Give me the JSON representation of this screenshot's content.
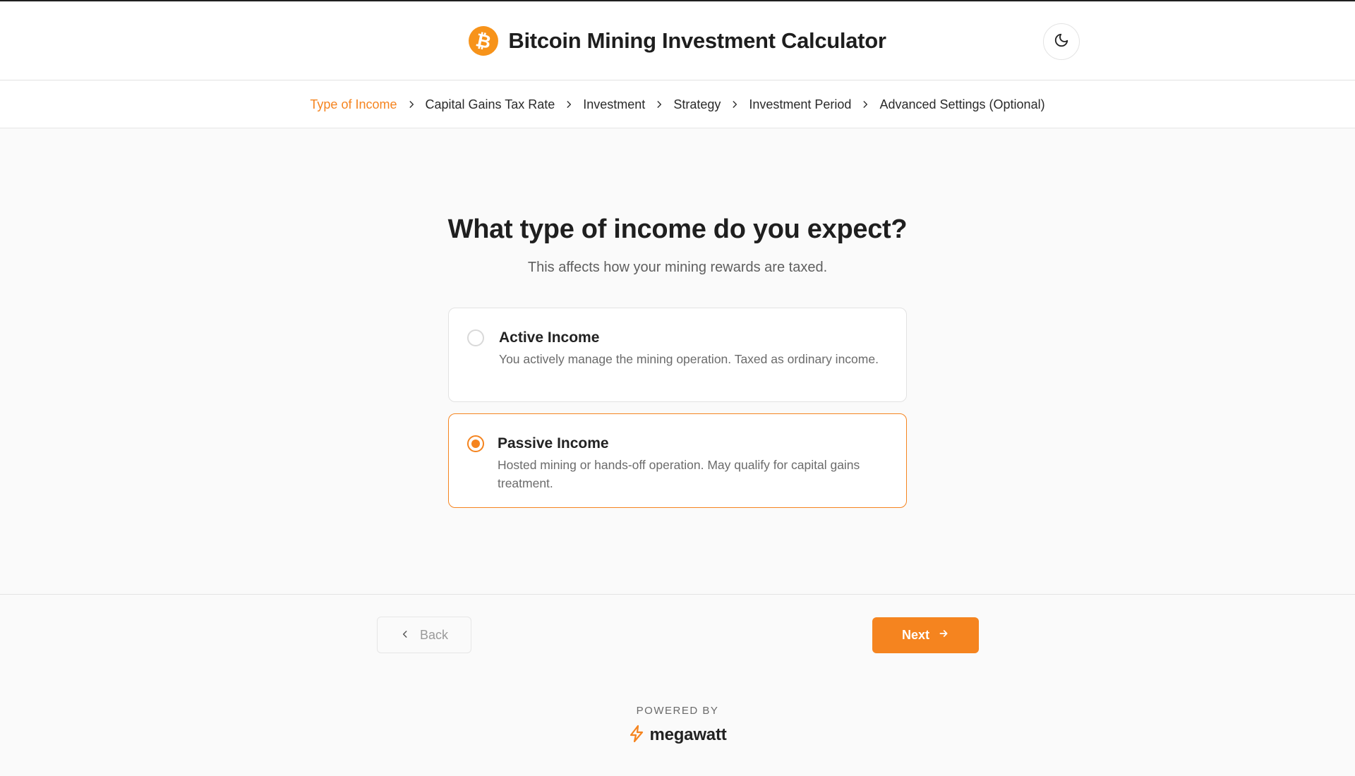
{
  "header": {
    "logo_symbol": "₿",
    "title": "Bitcoin Mining Investment Calculator",
    "theme_toggle_icon": "moon-icon"
  },
  "steps": [
    {
      "label": "Type of Income",
      "active": true
    },
    {
      "label": "Capital Gains Tax Rate",
      "active": false
    },
    {
      "label": "Investment",
      "active": false
    },
    {
      "label": "Strategy",
      "active": false
    },
    {
      "label": "Investment Period",
      "active": false
    },
    {
      "label": "Advanced Settings (Optional)",
      "active": false
    }
  ],
  "main": {
    "question": "What type of income do you expect?",
    "subtitle": "This affects how your mining rewards are taxed.",
    "options": [
      {
        "title": "Active Income",
        "description": "You actively manage the mining operation. Taxed as ordinary income.",
        "selected": false
      },
      {
        "title": "Passive Income",
        "description": "Hosted mining or hands-off operation. May qualify for capital gains treatment.",
        "selected": true
      }
    ]
  },
  "nav": {
    "back_label": "Back",
    "next_label": "Next"
  },
  "footer": {
    "powered_by": "POWERED BY",
    "brand": "megawatt"
  },
  "colors": {
    "accent": "#f5841f",
    "bitcoin": "#f7931a",
    "background": "#fafafa"
  }
}
